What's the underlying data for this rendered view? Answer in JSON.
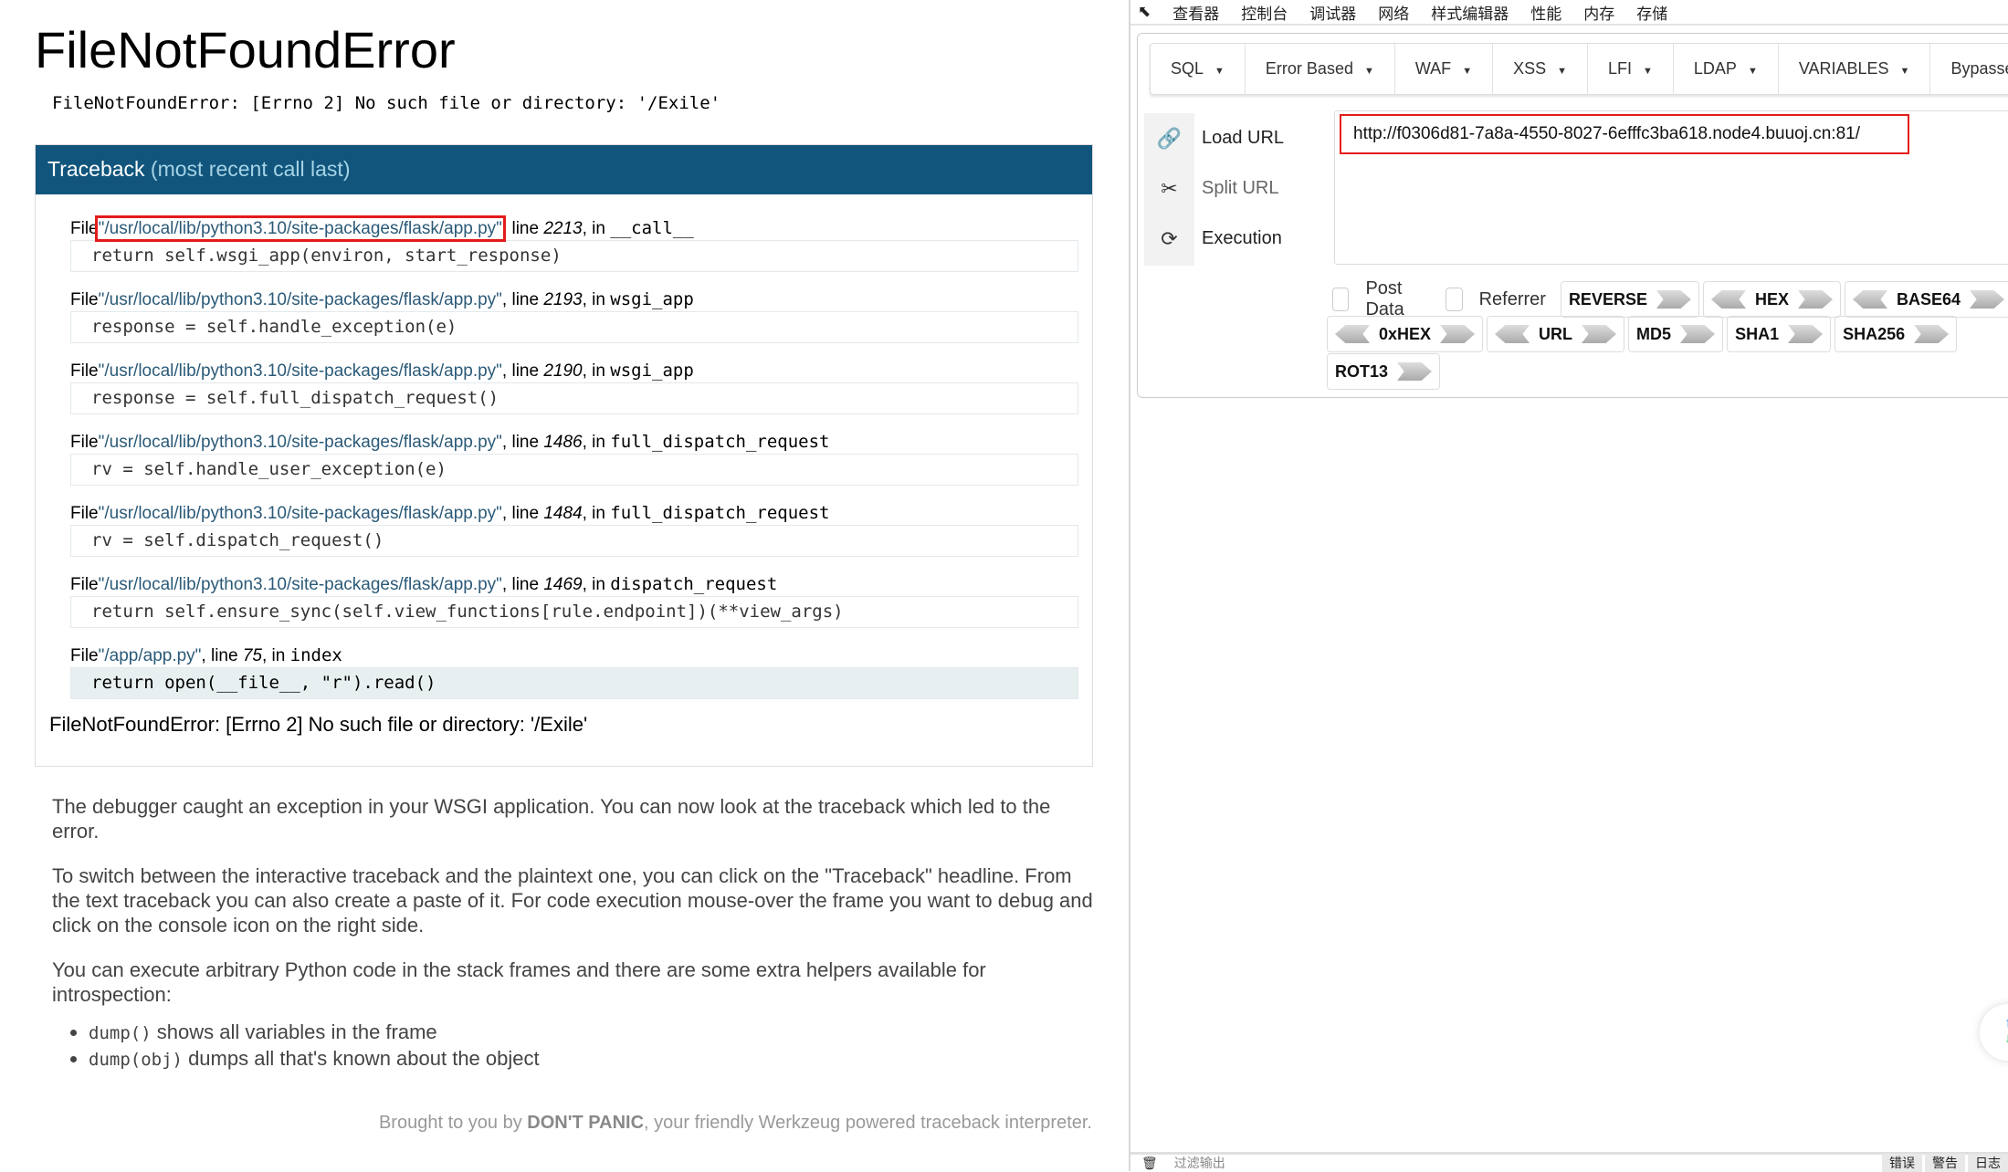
{
  "page": {
    "title": "FileNotFoundError",
    "error_line": "FileNotFoundError: [Errno 2] No such file or directory: '/Exile'",
    "traceback_title": "Traceback",
    "traceback_subtitle": "(most recent call last)",
    "frames": [
      {
        "file": "\"/usr/local/lib/python3.10/site-packages/flask/app.py\"",
        "line": "2213",
        "func": "__call__",
        "code": "return self.wsgi_app(environ, start_response)"
      },
      {
        "file": "\"/usr/local/lib/python3.10/site-packages/flask/app.py\"",
        "line": "2193",
        "func": "wsgi_app",
        "code": "response = self.handle_exception(e)"
      },
      {
        "file": "\"/usr/local/lib/python3.10/site-packages/flask/app.py\"",
        "line": "2190",
        "func": "wsgi_app",
        "code": "response = self.full_dispatch_request()"
      },
      {
        "file": "\"/usr/local/lib/python3.10/site-packages/flask/app.py\"",
        "line": "1486",
        "func": "full_dispatch_request",
        "code": "rv = self.handle_user_exception(e)"
      },
      {
        "file": "\"/usr/local/lib/python3.10/site-packages/flask/app.py\"",
        "line": "1484",
        "func": "full_dispatch_request",
        "code": "rv = self.dispatch_request()"
      },
      {
        "file": "\"/usr/local/lib/python3.10/site-packages/flask/app.py\"",
        "line": "1469",
        "func": "dispatch_request",
        "code": "return self.ensure_sync(self.view_functions[rule.endpoint])(**view_args)"
      },
      {
        "file": "\"/app/app.py\"",
        "line": "75",
        "func": "index",
        "code": "return open(__file__, \"r\").read()"
      }
    ],
    "file_word": "File",
    "line_word": ", line",
    "in_word": ", in",
    "final_error": "FileNotFoundError: [Errno 2] No such file or directory: '/Exile'",
    "para1": "The debugger caught an exception in your WSGI application. You can now look at the traceback which led to the error.",
    "para2": "To switch between the interactive traceback and the plaintext one, you can click on the \"Traceback\" headline. From the text traceback you can also create a paste of it. For code execution mouse-over the frame you want to debug and click on the console icon on the right side.",
    "para3": "You can execute arbitrary Python code in the stack frames and there are some extra helpers available for introspection:",
    "helpers": [
      {
        "code": "dump()",
        "text": " shows all variables in the frame"
      },
      {
        "code": "dump(obj)",
        "text": " dumps all that's known about the object"
      }
    ],
    "footer_prefix": "Brought to you by ",
    "footer_brand": "DON'T PANIC",
    "footer_suffix": ", your friendly Werkzeug powered traceback interpreter."
  },
  "devtools": {
    "tabs": [
      "查看器",
      "控制台",
      "调试器",
      "网络",
      "样式编辑器",
      "性能",
      "内存",
      "存储"
    ],
    "console_filter_placeholder": "过滤输出",
    "console_buttons": [
      "错误",
      "警告",
      "日志"
    ]
  },
  "hackbar": {
    "menus": [
      "SQL",
      "Error Based",
      "WAF",
      "XSS",
      "LFI",
      "LDAP",
      "VARIABLES",
      "Bypasser"
    ],
    "actions": [
      "Load URL",
      "Split URL",
      "Execution"
    ],
    "url": "http://f0306d81-7a8a-4550-8027-6efffc3ba618.node4.buuoj.cn:81/",
    "post_data": "Post Data",
    "referrer": "Referrer",
    "row1": [
      "REVERSE",
      "HEX",
      "BASE64"
    ],
    "row2": [
      "0xHEX",
      "URL",
      "MD5",
      "SHA1",
      "SHA256"
    ],
    "row3": [
      "ROT13"
    ]
  },
  "colors": {
    "traceback_header": "#11557c",
    "highlight": "#e31b1b"
  }
}
